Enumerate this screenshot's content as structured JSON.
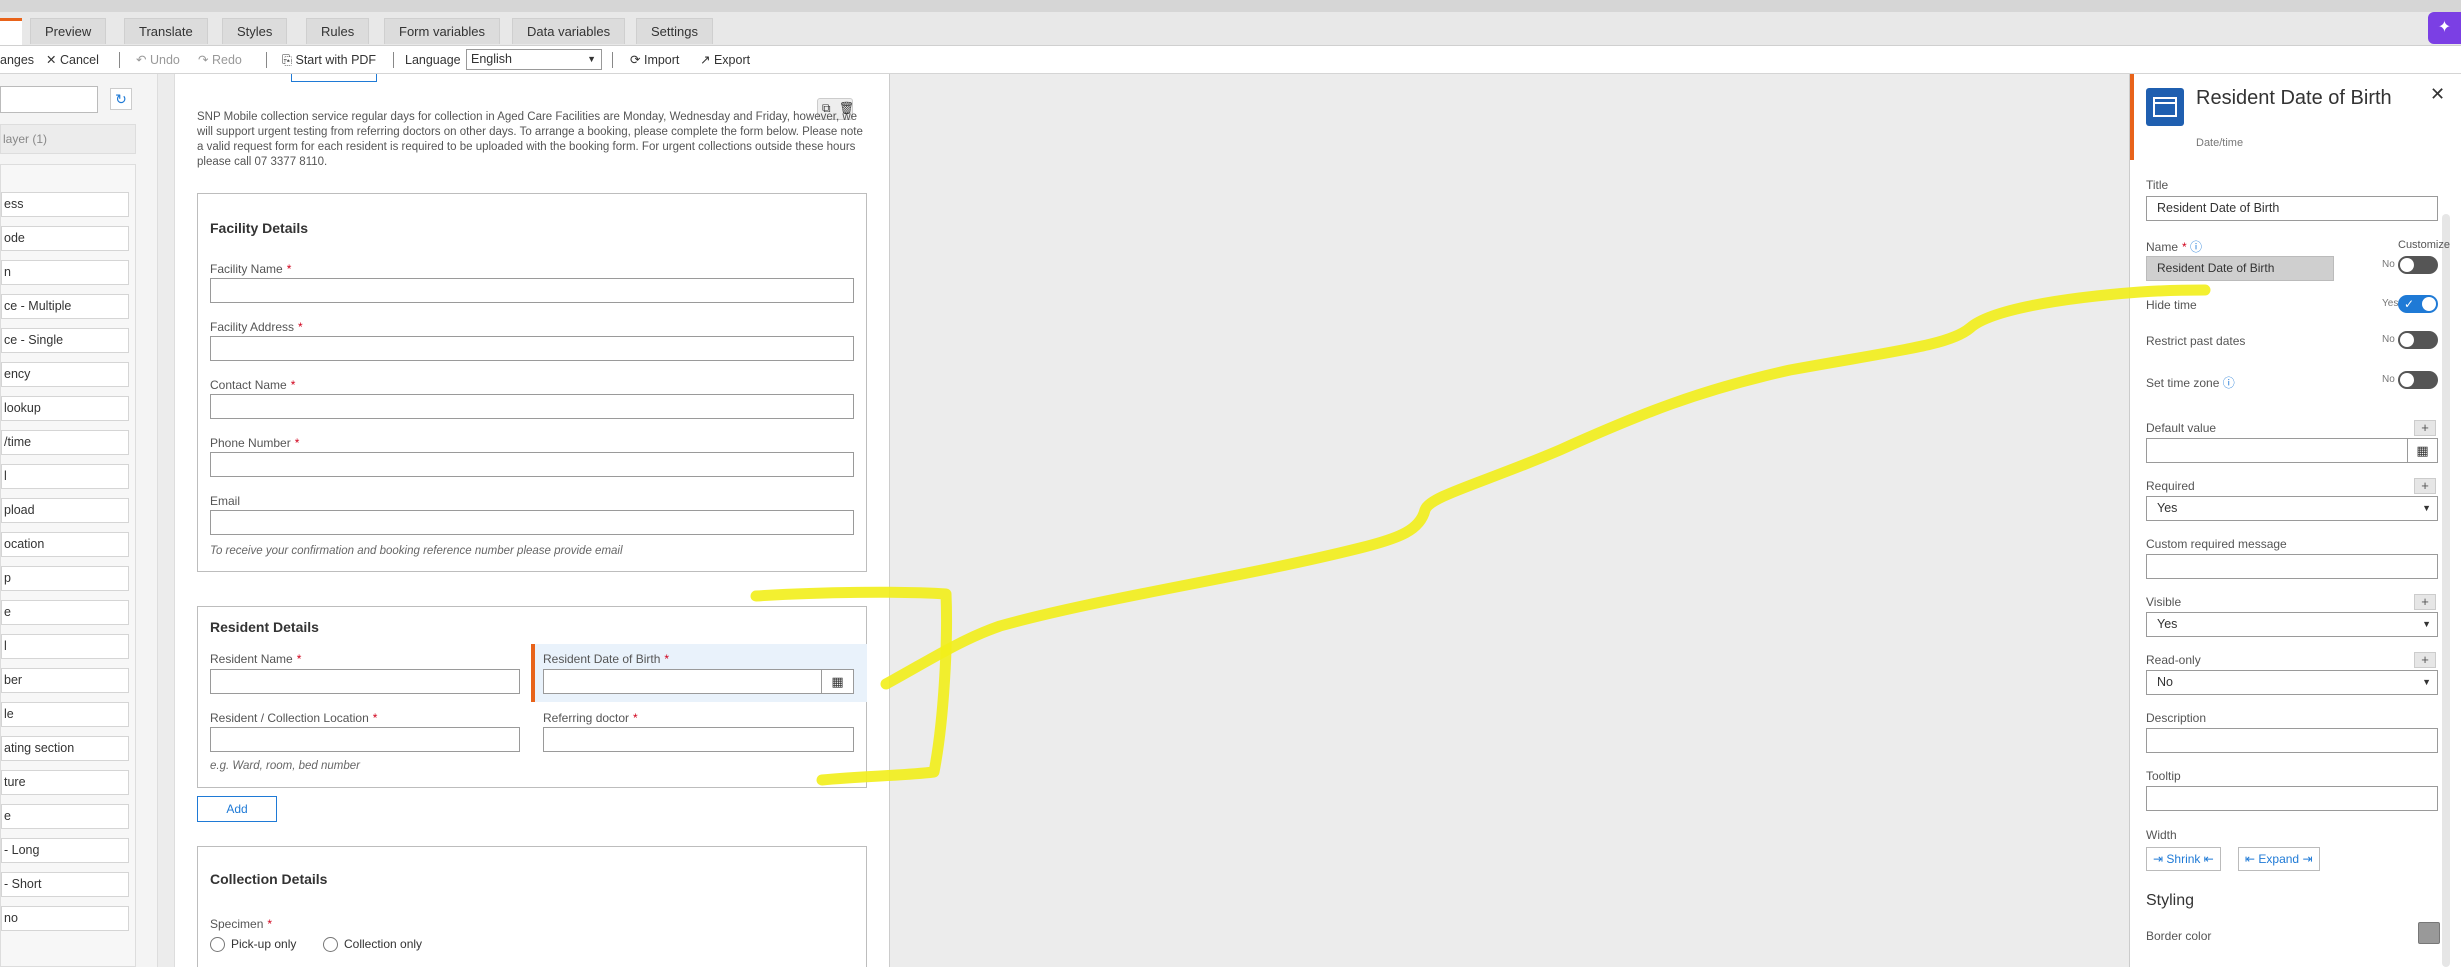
{
  "tabs": [
    "Preview",
    "Translate",
    "Styles",
    "Rules",
    "Form variables",
    "Data variables",
    "Settings"
  ],
  "toolbar": {
    "changes": "anges",
    "cancel": "Cancel",
    "undo": "Undo",
    "redo": "Redo",
    "start_pdf": "Start with PDF",
    "language_label": "Language",
    "language_value": "English",
    "import": "Import",
    "export": "Export"
  },
  "left_panel": {
    "layer": "layer (1)",
    "items": [
      "ess",
      "ode",
      "n",
      "ce - Multiple",
      "ce - Single",
      "ency",
      "lookup",
      "/time",
      "l",
      "pload",
      "ocation",
      "p",
      "e",
      "l",
      "ber",
      "le",
      "ating section",
      "ture",
      "e",
      "- Long",
      "- Short",
      "no"
    ]
  },
  "form": {
    "intro": "SNP Mobile collection service regular days for collection in Aged Care Facilities are Monday, Wednesday and Friday, however, we will support urgent testing from referring doctors on other days.  To arrange a booking, please complete the form below.  Please note a valid request form for each resident is required to be uploaded with the booking form.  For urgent collections outside these hours please call 07 3377 8110.",
    "facility": {
      "title": "Facility Details",
      "facility_name": "Facility Name",
      "facility_address": "Facility Address",
      "contact_name": "Contact Name",
      "phone_number": "Phone Number",
      "email": "Email",
      "email_hint": "To receive your confirmation and booking reference number please provide email"
    },
    "resident": {
      "title": "Resident Details",
      "resident_name": "Resident Name",
      "resident_dob": "Resident Date of Birth",
      "collection_location": "Resident / Collection Location",
      "referring_doctor": "Referring doctor",
      "location_hint": "e.g. Ward, room, bed number"
    },
    "add_button": "Add",
    "collection": {
      "title": "Collection Details",
      "specimen": "Specimen",
      "option_pickup": "Pick-up only",
      "option_collection": "Collection only"
    }
  },
  "properties": {
    "title": "Resident Date of Birth",
    "subtitle": "Date/time",
    "title_label": "Title",
    "title_value": "Resident Date of Birth",
    "name_label": "Name",
    "name_value": "Resident Date of Birth",
    "customize": "Customize",
    "no": "No",
    "yes": "Yes",
    "hide_time": "Hide time",
    "restrict_past": "Restrict past dates",
    "set_time_zone": "Set time zone",
    "default_value": "Default value",
    "required": "Required",
    "required_value": "Yes",
    "custom_required": "Custom required message",
    "visible": "Visible",
    "visible_value": "Yes",
    "read_only": "Read-only",
    "read_only_value": "No",
    "description": "Description",
    "tooltip": "Tooltip",
    "width": "Width",
    "shrink": "Shrink",
    "expand": "Expand",
    "styling": "Styling",
    "border_color": "Border color"
  },
  "colors": {
    "accent": "#1f7ad6",
    "highlight_bar": "#e8631a",
    "annotation": "#f2ee19",
    "required_star": "#d0001b"
  }
}
